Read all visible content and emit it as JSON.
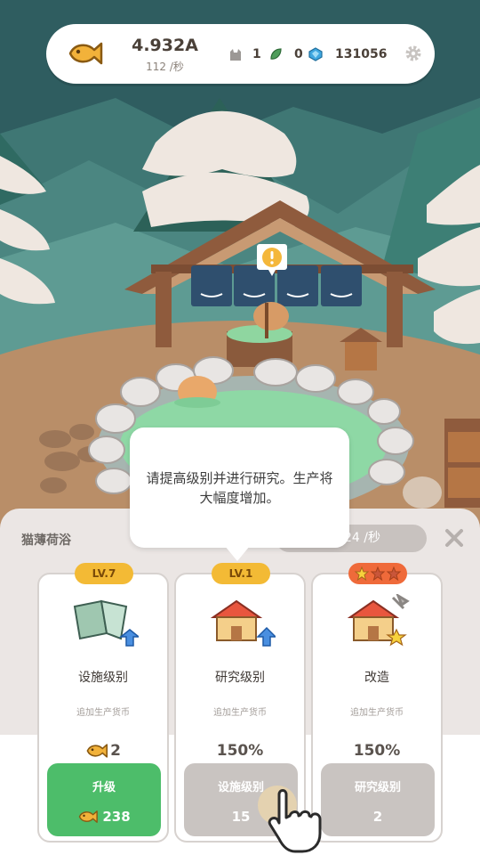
{
  "topbar": {
    "currency_value": "4.932A",
    "currency_rate": "112 /秒",
    "cat_count": "1",
    "leaf_count": "0",
    "gem_count": "131056"
  },
  "tooltip": {
    "text": "请提高级别并进行研究。生产将大幅度增加。"
  },
  "panel": {
    "title": "猫薄荷浴",
    "rate_suffix": "24 /秒"
  },
  "cards": [
    {
      "badge": "LV.7",
      "name": "设施级别",
      "desc": "追加生产货币",
      "value": "2",
      "button_label": "升级",
      "button_value": "238"
    },
    {
      "badge": "LV.1",
      "name": "研究级别",
      "desc": "追加生产货币",
      "value": "150%",
      "button_label": "设施级别",
      "button_value": "15"
    },
    {
      "badge": "",
      "stars_filled": 1,
      "stars_total": 3,
      "name": "改造",
      "desc": "追加生产货币",
      "value": "150%",
      "button_label": "研究级别",
      "button_value": "2"
    }
  ],
  "colors": {
    "accent_green": "#4dbd6a",
    "badge_yellow": "#f3ba35",
    "badge_orange": "#ef6a3a",
    "currency_gold": "#f2b23a"
  }
}
